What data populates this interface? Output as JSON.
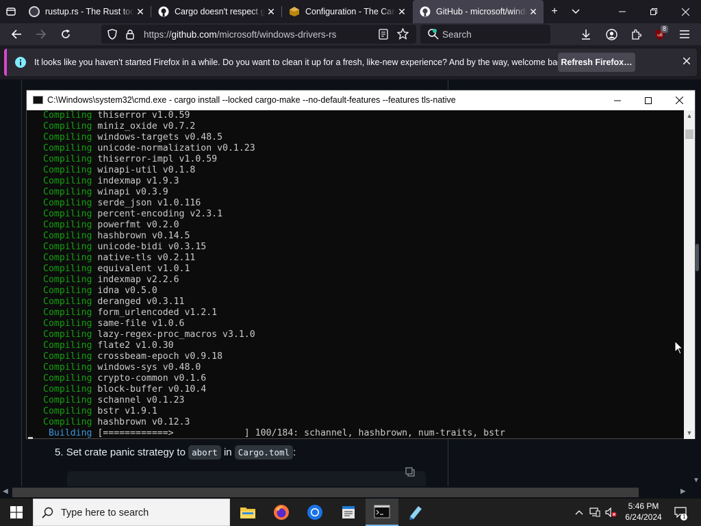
{
  "browser": {
    "tabs": [
      {
        "title": "rustup.rs - The Rust toolchain installer",
        "favicon_color": "#d7d7db"
      },
      {
        "title": "Cargo doesn't respect git config",
        "favicon_color": "#fbfbfe"
      },
      {
        "title": "Configuration - The Cargo Book",
        "favicon_color": "#b8860b"
      },
      {
        "title": "GitHub - microsoft/windows-drivers-rs",
        "favicon_color": "#fbfbfe"
      }
    ],
    "url_prefix": "https://",
    "url_host": "github.com",
    "url_path": "/microsoft/windows-drivers-rs",
    "search_placeholder": "Search",
    "extension_badge": "8"
  },
  "notification": {
    "message": "It looks like you haven’t started Firefox in a while. Do you want to clean it up for a fresh, like-new experience? And by the way, welcome back!",
    "button_label": "Refresh Firefox…"
  },
  "page": {
    "step_number": "5.",
    "step_prefix": "Set crate panic strategy to",
    "step_code1": "abort",
    "step_in": "in",
    "step_code2": "Cargo.toml",
    "step_suffix": ":"
  },
  "cmd": {
    "title": "C:\\Windows\\system32\\cmd.exe - cargo  install --locked cargo-make --no-default-features --features tls-native",
    "lines": [
      {
        "status": "Compiling",
        "text": "thiserror v1.0.59"
      },
      {
        "status": "Compiling",
        "text": "miniz_oxide v0.7.2"
      },
      {
        "status": "Compiling",
        "text": "windows-targets v0.48.5"
      },
      {
        "status": "Compiling",
        "text": "unicode-normalization v0.1.23"
      },
      {
        "status": "Compiling",
        "text": "thiserror-impl v1.0.59"
      },
      {
        "status": "Compiling",
        "text": "winapi-util v0.1.8"
      },
      {
        "status": "Compiling",
        "text": "indexmap v1.9.3"
      },
      {
        "status": "Compiling",
        "text": "winapi v0.3.9"
      },
      {
        "status": "Compiling",
        "text": "serde_json v1.0.116"
      },
      {
        "status": "Compiling",
        "text": "percent-encoding v2.3.1"
      },
      {
        "status": "Compiling",
        "text": "powerfmt v0.2.0"
      },
      {
        "status": "Compiling",
        "text": "hashbrown v0.14.5"
      },
      {
        "status": "Compiling",
        "text": "unicode-bidi v0.3.15"
      },
      {
        "status": "Compiling",
        "text": "native-tls v0.2.11"
      },
      {
        "status": "Compiling",
        "text": "equivalent v1.0.1"
      },
      {
        "status": "Compiling",
        "text": "indexmap v2.2.6"
      },
      {
        "status": "Compiling",
        "text": "idna v0.5.0"
      },
      {
        "status": "Compiling",
        "text": "deranged v0.3.11"
      },
      {
        "status": "Compiling",
        "text": "form_urlencoded v1.2.1"
      },
      {
        "status": "Compiling",
        "text": "same-file v1.0.6"
      },
      {
        "status": "Compiling",
        "text": "lazy-regex-proc_macros v3.1.0"
      },
      {
        "status": "Compiling",
        "text": "flate2 v1.0.30"
      },
      {
        "status": "Compiling",
        "text": "crossbeam-epoch v0.9.18"
      },
      {
        "status": "Compiling",
        "text": "windows-sys v0.48.0"
      },
      {
        "status": "Compiling",
        "text": "crypto-common v0.1.6"
      },
      {
        "status": "Compiling",
        "text": "block-buffer v0.10.4"
      },
      {
        "status": "Compiling",
        "text": "schannel v0.1.23"
      },
      {
        "status": "Compiling",
        "text": "bstr v1.9.1"
      },
      {
        "status": "Compiling",
        "text": "hashbrown v0.12.3"
      }
    ],
    "building_label": "Building",
    "building_bar": "[============>             ]",
    "building_progress": "100/184: schannel, hashbrown, num-traits, bstr"
  },
  "taskbar": {
    "search_placeholder": "Type here to search",
    "time": "5:46 PM",
    "date": "6/24/2024",
    "notification_count": "1"
  }
}
